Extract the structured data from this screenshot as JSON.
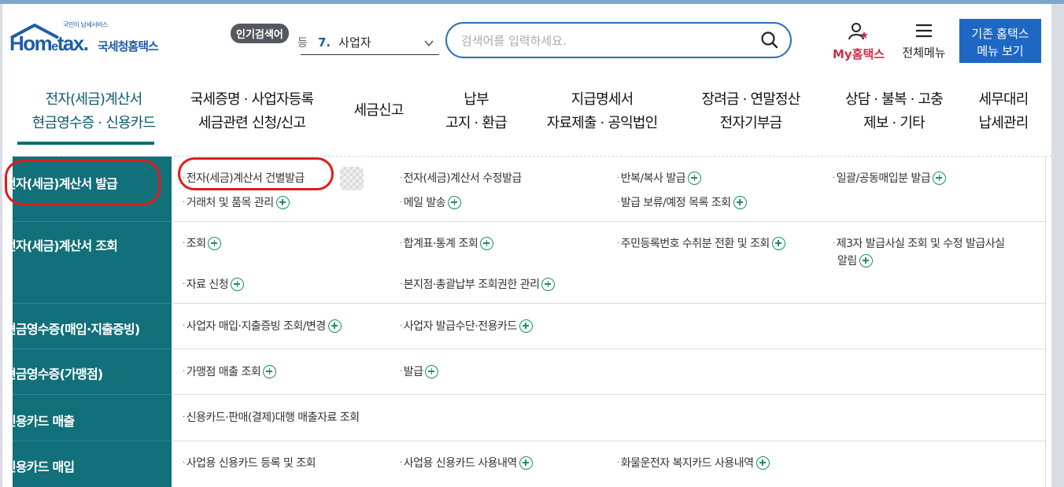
{
  "header": {
    "logo_small": "국민이 납세서비스",
    "logo_word_pre": "Hom",
    "logo_word_e": "e",
    "logo_word_post": "tax.",
    "logo_kor": "국세청홈택스",
    "popular_badge": "인기검색어",
    "popular_tail": "등",
    "popular_rank": "7.",
    "popular_term": "사업자",
    "search_placeholder": "검색어를 입력하세요.",
    "my_hometax_pre": "My",
    "my_hometax_post": "홈택스",
    "full_menu": "전체메뉴",
    "old_menu_line1": "기존 홈택스",
    "old_menu_line2": "메뉴 보기"
  },
  "gnb": [
    {
      "line1": "전자(세금)계산서",
      "line2": "현금영수증 · 신용카드"
    },
    {
      "line1": "국세증명 · 사업자등록",
      "line2": "세금관련 신청/신고"
    },
    {
      "line1": "세금신고",
      "line2": ""
    },
    {
      "line1": "납부",
      "line2": "고지 · 환급"
    },
    {
      "line1": "지급명세서",
      "line2": "자료제출 · 공익법인"
    },
    {
      "line1": "장려금 · 연말정산",
      "line2": "전자기부금"
    },
    {
      "line1": "상담 · 불복 · 고충",
      "line2": "제보 · 기타"
    },
    {
      "line1": "세무대리",
      "line2": "납세관리"
    }
  ],
  "categories": [
    "전자(세금)계산서 발급",
    "전자(세금)계산서 조회",
    "현금영수증(매입·지출증빙)",
    "현금영수증(가맹점)",
    "신용카드 매출",
    "신용카드 매입"
  ],
  "links": {
    "r1": [
      "전자(세금)계산서 건별발급",
      "전자(세금)계산서 수정발급",
      "반복/복사 발급",
      "일괄/공동매입분 발급",
      "거래처 및 품목 관리",
      "메일 발송",
      "발급 보류/예정 목록 조회"
    ],
    "r2": [
      "조회",
      "합계표·통계 조회",
      "주민등록번호 수취분 전환 및 조회",
      "제3자 발급사실 조회 및 수정 발급사실",
      "알림",
      "자료 신청",
      "본지점·총괄납부 조회권한 관리"
    ],
    "r3": [
      "사업자 매입·지출증빙 조회/변경",
      "사업자 발급수단·전용카드"
    ],
    "r4": [
      "가맹점 매출 조회",
      "발급"
    ],
    "r5": [
      "신용카드·판매(결제)대행 매출자료 조회"
    ],
    "r6": [
      "사업용 신용카드 등록 및 조회",
      "사업용 신용카드 사용내역",
      "화물운전자 복지카드 사용내역"
    ]
  },
  "colors": {
    "brand_blue": "#1e5ca8",
    "category_teal": "#12707a",
    "highlight_red": "#e01b1b",
    "plus_green": "#1a8f62"
  }
}
